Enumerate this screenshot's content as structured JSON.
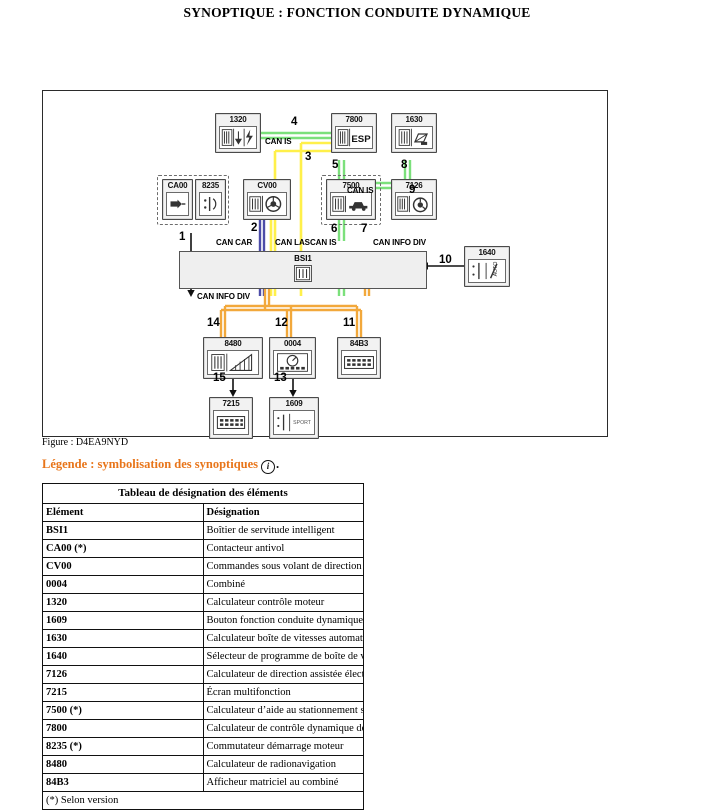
{
  "page": {
    "title": "SYNOPTIQUE : FONCTION CONDUITE DYNAMIQUE",
    "figure_caption": "Figure : D4EA9NYD",
    "legend_text": "Légende : symbolisation des synoptiques",
    "legend_icon": "info-icon",
    "legend_period": "."
  },
  "diagram": {
    "bsi": {
      "label": "BSI1",
      "icon": "ecu-module-icon"
    },
    "components": [
      {
        "id": "CA00",
        "label": "CA00",
        "icon": "antitheft-switch-icon",
        "optional": true
      },
      {
        "id": "8235",
        "label": "8235",
        "icon": "starter-switch-icon",
        "optional": true
      },
      {
        "id": "CV00",
        "label": "CV00",
        "icon": "steering-wheel-controls-icon",
        "optional": false
      },
      {
        "id": "1320",
        "label": "1320",
        "icon": "engine-ecu-icon",
        "optional": false
      },
      {
        "id": "7800",
        "label": "7800",
        "icon": "esp-ecu-icon",
        "optional": false
      },
      {
        "id": "1630",
        "label": "1630",
        "icon": "gearbox-ecu-icon",
        "optional": false
      },
      {
        "id": "7500",
        "label": "7500",
        "icon": "parking-aid-ecu-icon",
        "optional": true
      },
      {
        "id": "7126",
        "label": "7126",
        "icon": "power-steering-ecu-icon",
        "optional": false
      },
      {
        "id": "1640",
        "label": "1640",
        "icon": "gearbox-selector-icon",
        "optional": false
      },
      {
        "id": "8480",
        "label": "8480",
        "icon": "radionav-ecu-icon",
        "optional": false
      },
      {
        "id": "0004",
        "label": "0004",
        "icon": "instrument-cluster-icon",
        "optional": false
      },
      {
        "id": "84B3",
        "label": "84B3",
        "icon": "matrix-display-icon",
        "optional": false
      },
      {
        "id": "7215",
        "label": "7215",
        "icon": "multifunction-screen-icon",
        "optional": false
      },
      {
        "id": "1609",
        "label": "1609",
        "icon": "dynamic-drive-button-icon",
        "optional": false
      }
    ],
    "bus_labels": [
      {
        "name": "CAN IS",
        "text": "CAN IS"
      },
      {
        "name": "CAN IS 2",
        "text": "CAN IS"
      },
      {
        "name": "CAN CAR",
        "text": "CAN CAR"
      },
      {
        "name": "CAN LAS",
        "text": "CAN LAS"
      },
      {
        "name": "CAN IS 3",
        "text": "CAN IS"
      },
      {
        "name": "CAN INFO DIV",
        "text": "CAN INFO DIV"
      },
      {
        "name": "CAN INFO DIV 2",
        "text": "CAN INFO DIV"
      }
    ],
    "link_numbers": [
      "1",
      "2",
      "3",
      "4",
      "5",
      "6",
      "7",
      "8",
      "9",
      "10",
      "11",
      "12",
      "13",
      "14",
      "15"
    ],
    "bus_colors": {
      "can_is_green": "#7BE07B",
      "can_las_yellow": "#FFF04A",
      "can_car_blue": "#4C4CA8",
      "can_info_div_orange": "#F2A83B",
      "arrow_black": "#111111"
    }
  },
  "table": {
    "title": "Tableau de désignation des éléments",
    "headers": [
      "Elément",
      "Désignation"
    ],
    "rows": [
      {
        "element": "BSI1",
        "designation": "Boîtier de servitude intelligent"
      },
      {
        "element": "CA00 (*)",
        "designation": "Contacteur antivol"
      },
      {
        "element": "CV00",
        "designation": "Commandes sous volant de direction"
      },
      {
        "element": "0004",
        "designation": "Combiné"
      },
      {
        "element": "1320",
        "designation": "Calculateur contrôle moteur"
      },
      {
        "element": "1609",
        "designation": "Bouton fonction conduite dynamique"
      },
      {
        "element": "1630",
        "designation": "Calculateur boîte de vitesses automatique"
      },
      {
        "element": "1640",
        "designation": "Sélecteur de programme de boîte de vitesses automatique"
      },
      {
        "element": "7126",
        "designation": "Calculateur de direction assistée électrique"
      },
      {
        "element": "7215",
        "designation": "Écran multifonction"
      },
      {
        "element": "7500 (*)",
        "designation": "Calculateur d’aide au stationnement semi-automatique"
      },
      {
        "element": "7800",
        "designation": "Calculateur de contrôle dynamique de stabilité"
      },
      {
        "element": "8235 (*)",
        "designation": "Commutateur démarrage moteur"
      },
      {
        "element": "8480",
        "designation": "Calculateur de radionavigation"
      },
      {
        "element": "84B3",
        "designation": "Afficheur matriciel au combiné"
      }
    ],
    "footnote": "(*) Selon version"
  }
}
